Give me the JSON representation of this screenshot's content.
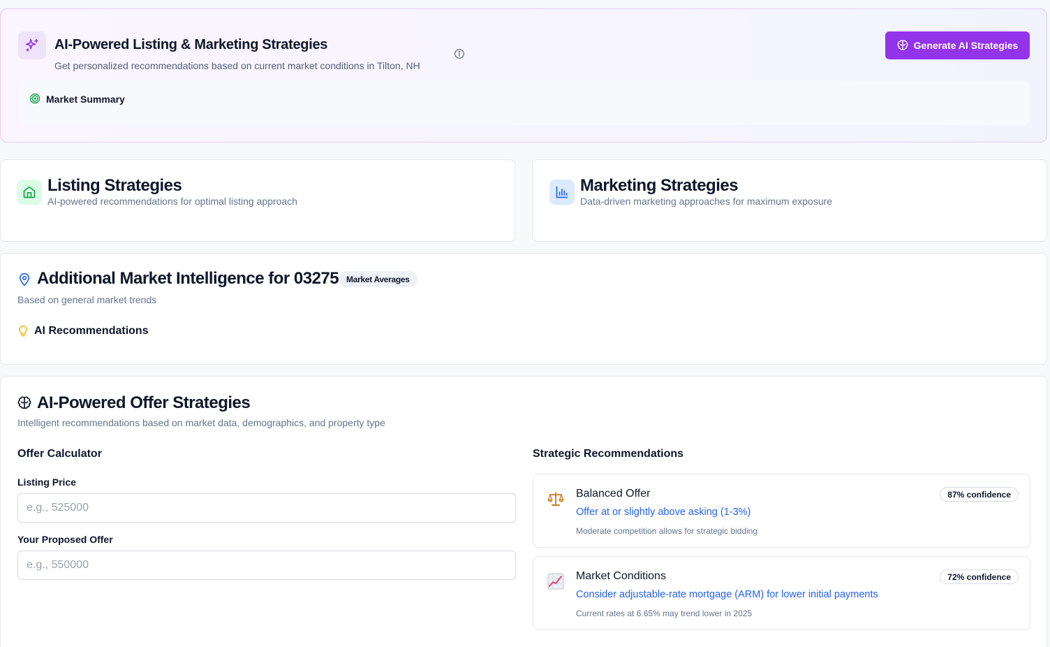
{
  "hero": {
    "title": "AI-Powered Listing & Marketing Strategies",
    "subtitle": "Get personalized recommendations based on current market conditions in Tilton, NH",
    "generate_button": "Generate AI Strategies",
    "market_summary_label": "Market Summary",
    "accent_color": "#9333ea"
  },
  "listing": {
    "title": "Listing Strategies",
    "subtitle": "AI-powered recommendations for optimal listing approach",
    "icon": "home-icon"
  },
  "marketing": {
    "title": "Marketing Strategies",
    "subtitle": "Data-driven marketing approaches for maximum exposure",
    "icon": "bar-chart-icon"
  },
  "intel": {
    "title": "Additional Market Intelligence for 03275",
    "badge": "Market Averages",
    "subtitle": "Based on general market trends",
    "recommendations_label": "AI Recommendations"
  },
  "offer": {
    "title": "AI-Powered Offer Strategies",
    "subtitle": "Intelligent recommendations based on market data, demographics, and property type",
    "calculator_title": "Offer Calculator",
    "listing_price_label": "Listing Price",
    "listing_price_placeholder": "e.g., 525000",
    "listing_price_value": "",
    "proposed_offer_label": "Your Proposed Offer",
    "proposed_offer_placeholder": "e.g., 550000",
    "proposed_offer_value": "",
    "recommendations_title": "Strategic Recommendations",
    "recommendations": [
      {
        "icon": "balance-scale-icon",
        "title": "Balanced Offer",
        "action": "Offer at or slightly above asking (1-3%)",
        "reason": "Moderate competition allows for strategic bidding",
        "confidence": "87% confidence"
      },
      {
        "icon": "chart-increasing-icon",
        "title": "Market Conditions",
        "action": "Consider adjustable-rate mortgage (ARM) for lower initial payments",
        "reason": "Current rates at 6.65% may trend lower in 2025",
        "confidence": "72% confidence"
      }
    ]
  }
}
